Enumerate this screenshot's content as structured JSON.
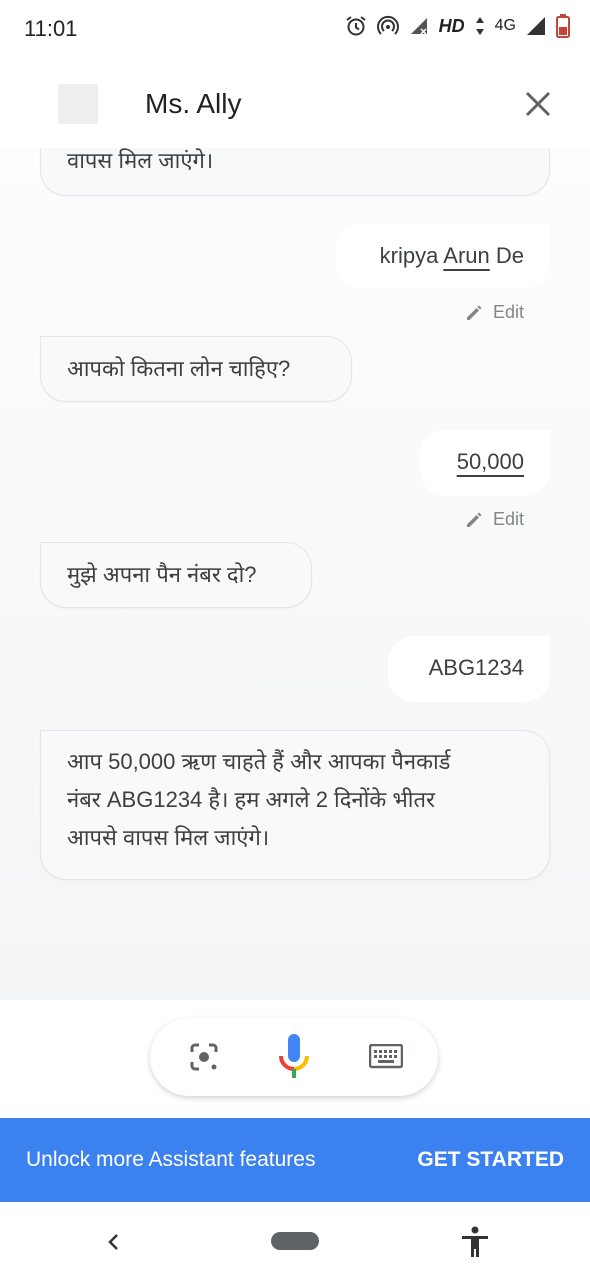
{
  "status_bar": {
    "time": "11:01",
    "hd_label": "HD",
    "network_label": "4G",
    "icons": [
      "alarm-icon",
      "hotspot-icon",
      "signal-no-data-icon",
      "data-arrows-icon",
      "signal-icon",
      "battery-icon"
    ]
  },
  "header": {
    "title": "Ms. Ally",
    "close_icon": "close-icon"
  },
  "messages": [
    {
      "sender": "bot",
      "text": "वापस मिल जाएंगे।"
    },
    {
      "sender": "user",
      "text_prefix": "kripya ",
      "text_underlined": "Arun",
      "text_suffix": " De",
      "edit_label": "Edit"
    },
    {
      "sender": "bot",
      "text": "आपको कितना लोन चाहिए?"
    },
    {
      "sender": "user",
      "text_underlined": "50,000",
      "edit_label": "Edit"
    },
    {
      "sender": "bot",
      "text": "मुझे अपना पैन नंबर दो?"
    },
    {
      "sender": "user",
      "text": "ABG1234"
    },
    {
      "sender": "bot",
      "lines": [
        "आप 50,000 ऋण चाहते हैं और आपका पैनकार्ड",
        "नंबर ABG1234 है। हम अगले 2 दिनोंके भीतर",
        "आपसे वापस मिल जाएंगे।"
      ]
    }
  ],
  "input_bar": {
    "icons": [
      "lens-icon",
      "microphone-icon",
      "keyboard-icon"
    ]
  },
  "banner": {
    "text": "Unlock more Assistant features",
    "cta": "GET STARTED",
    "color": "#3b82f0"
  },
  "nav_bar": {
    "icons": [
      "back-icon",
      "home-pill-icon",
      "accessibility-icon"
    ]
  }
}
